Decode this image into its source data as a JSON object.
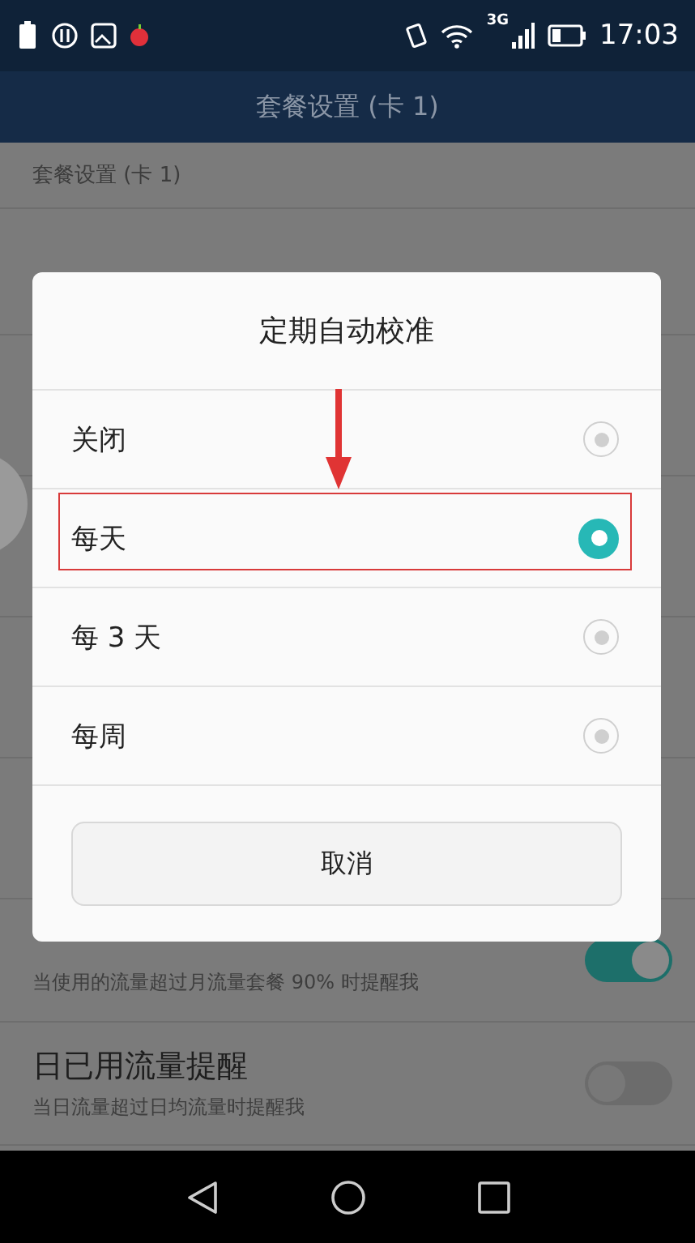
{
  "status_bar": {
    "network": "3G",
    "time": "17:03"
  },
  "title": "套餐设置 (卡 1)",
  "section_header": "套餐设置 (卡 1)",
  "toggles": [
    {
      "subtitle": "当使用的流量超过月流量套餐 90% 时提醒我",
      "on": true
    },
    {
      "title": "日已用流量提醒",
      "subtitle": "当日流量超过日均流量时提醒我",
      "on": false
    }
  ],
  "dialog": {
    "title": "定期自动校准",
    "options": [
      {
        "label": "关闭",
        "selected": false
      },
      {
        "label": "每天",
        "selected": true
      },
      {
        "label": "每 3 天",
        "selected": false
      },
      {
        "label": "每周",
        "selected": false
      }
    ],
    "cancel": "取消"
  }
}
